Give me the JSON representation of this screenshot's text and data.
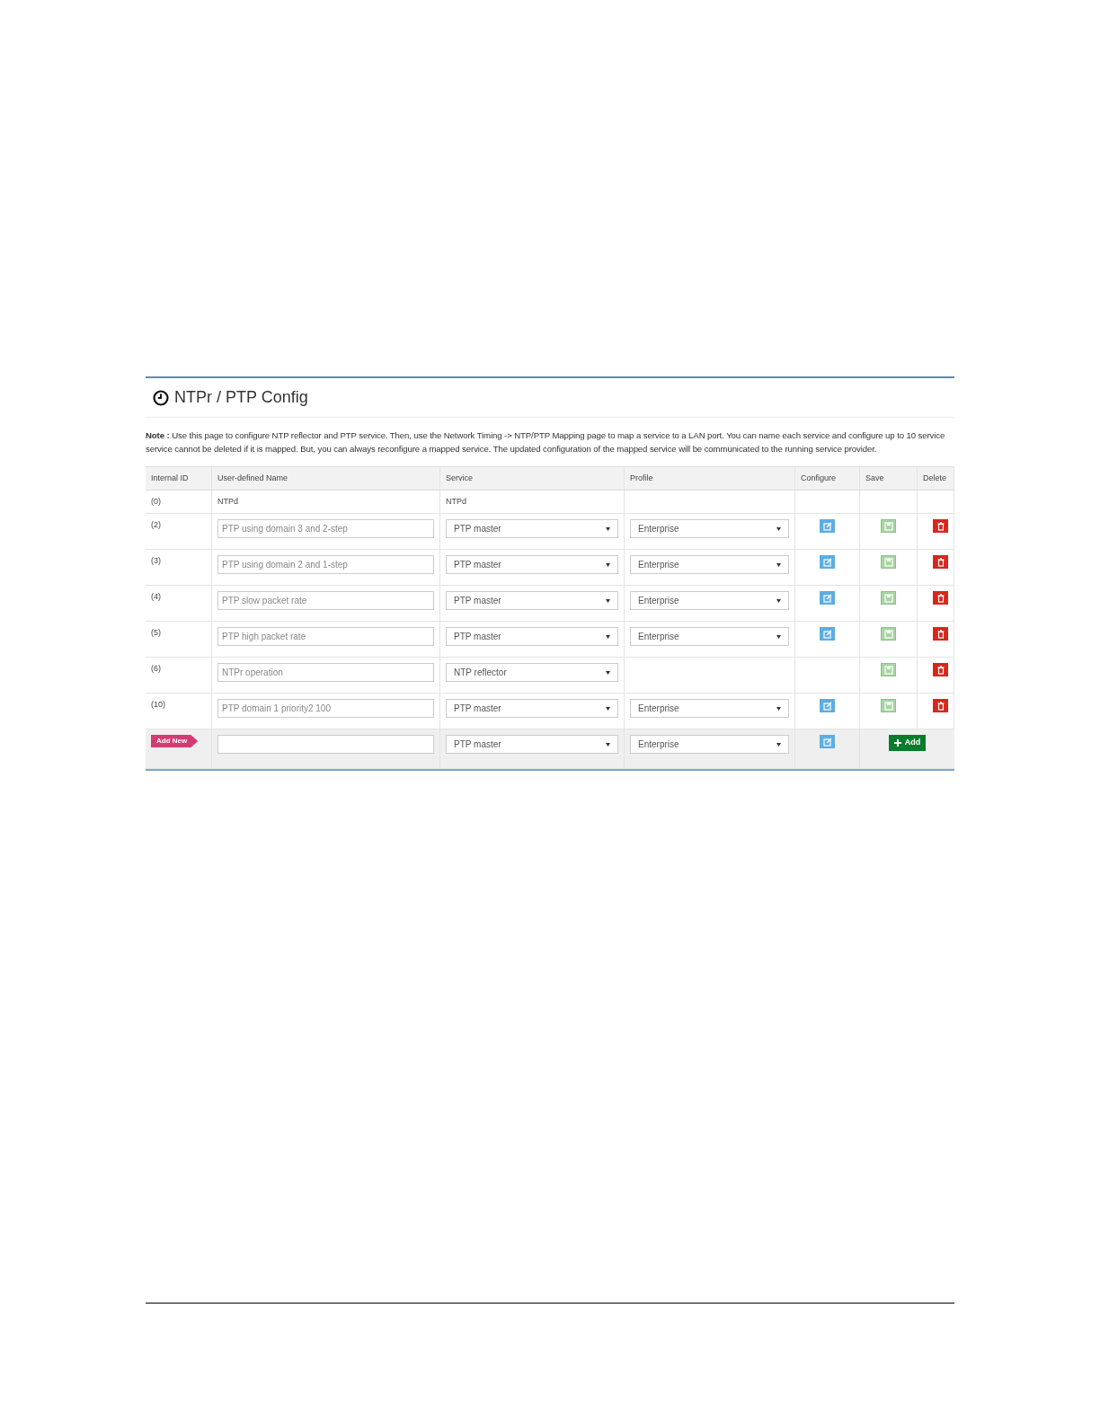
{
  "panel": {
    "title": "NTPr / PTP Config",
    "note_lines": [
      "**Note :** Use this page to configure NTP reflector and PTP service. Then, use the Network Timing -> NTP/PTP Mapping page to map a service to a LAN port. You can name each service and configure up to 10 service",
      "service cannot be deleted if it is mapped. But, you can always reconfigure a mapped service. The updated configuration of the mapped service will be communicated to the running service provider."
    ],
    "table": {
      "columns": [
        "Internal ID",
        "User-defined Name",
        "Service",
        "Profile",
        "Configure",
        "Save",
        "Delete"
      ],
      "rows": [
        {
          "kind": "fixed",
          "id": "(0)",
          "name": "NTPd",
          "service": "NTPd"
        },
        {
          "kind": "editable",
          "id": "(2)",
          "name": "PTP using domain 3 and 2-step",
          "service": "PTP master",
          "profile": "Enterprise",
          "configure": true
        },
        {
          "kind": "editable",
          "id": "(3)",
          "name": "PTP using domain 2 and 1-step",
          "service": "PTP master",
          "profile": "Enterprise",
          "configure": true
        },
        {
          "kind": "editable",
          "id": "(4)",
          "name": "PTP slow packet rate",
          "service": "PTP master",
          "profile": "Enterprise",
          "configure": true
        },
        {
          "kind": "editable",
          "id": "(5)",
          "name": "PTP high packet rate",
          "service": "PTP master",
          "profile": "Enterprise",
          "configure": true
        },
        {
          "kind": "editable",
          "id": "(6)",
          "name": "NTPr operation",
          "service": "NTP reflector",
          "configure": false
        },
        {
          "kind": "editable",
          "id": "(10)",
          "name": "PTP domain 1 priority2 100",
          "service": "PTP master",
          "profile": "Enterprise",
          "configure": true
        }
      ],
      "add_row": {
        "badge": "Add New",
        "service": "PTP master",
        "profile": "Enterprise",
        "button": "Add"
      }
    }
  }
}
